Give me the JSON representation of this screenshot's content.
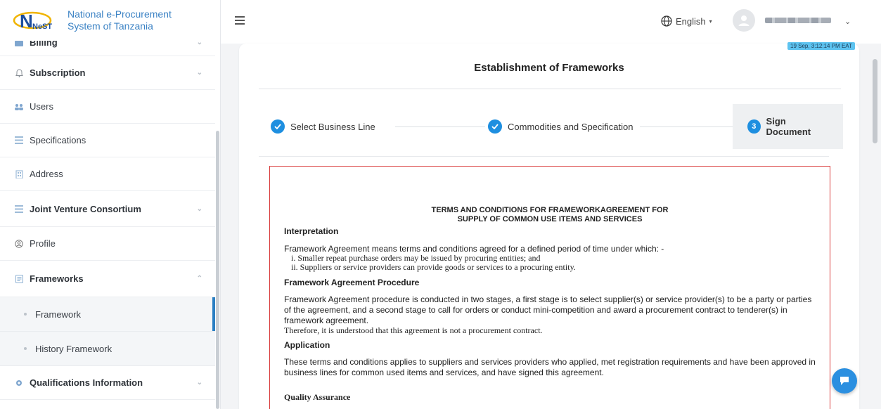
{
  "app": {
    "name_line1": "National e-Procurement",
    "name_line2": "System of Tanzania",
    "logo_text": "NeST",
    "brand_color": "#3b82c4"
  },
  "sidebar": {
    "items": [
      {
        "label": "Billing",
        "icon": "billing-icon",
        "bold": true,
        "has_chevron": true
      },
      {
        "label": "Subscription",
        "icon": "bell-icon",
        "bold": true,
        "has_chevron": true
      },
      {
        "label": "Users",
        "icon": "users-icon",
        "bold": false
      },
      {
        "label": "Specifications",
        "icon": "list-icon",
        "bold": false
      },
      {
        "label": "Address",
        "icon": "building-icon",
        "bold": false
      },
      {
        "label": "Joint Venture Consortium",
        "icon": "list-icon",
        "bold": true,
        "has_chevron": true
      },
      {
        "label": "Profile",
        "icon": "profile-icon",
        "bold": false
      },
      {
        "label": "Frameworks",
        "icon": "document-icon",
        "bold": true,
        "has_chevron": true,
        "expanded": true
      },
      {
        "label": "Qualifications Information",
        "icon": "gear-icon",
        "bold": true,
        "has_chevron": true
      }
    ],
    "subitems": [
      {
        "label": "Framework",
        "active": true
      },
      {
        "label": "History Framework",
        "active": false
      }
    ]
  },
  "topbar": {
    "language": "English",
    "clock": "19 Sep, 3:12:14 PM EAT"
  },
  "page": {
    "title": "Establishment of Frameworks",
    "steps": [
      {
        "label": "Select Business Line",
        "status": "done"
      },
      {
        "label": "Commodities and Specification",
        "status": "done"
      },
      {
        "number": "3",
        "label": "Sign Document",
        "status": "current"
      }
    ]
  },
  "document": {
    "heading_line1": "TERMS AND CONDITIONS FOR FRAMEWORKAGREEMENT FOR",
    "heading_line2": "SUPPLY OF COMMON USE ITEMS AND SERVICES",
    "interpretation_title": "Interpretation",
    "interpretation_text": "Framework Agreement means terms and conditions agreed for a defined period of time under which: -",
    "interpretation_item1": "i. Smaller repeat purchase orders may be issued by procuring entities; and",
    "interpretation_item2": "ii. Suppliers or service providers can provide goods or services to a procuring entity.",
    "procedure_title": "Framework Agreement Procedure",
    "procedure_text": "Framework Agreement procedure is conducted in two stages, a first stage is to select supplier(s) or service provider(s) to be a party or parties of the agreement, and a second stage to call for orders or conduct mini-competition and award a procurement contract to tenderer(s) in framework agreement.",
    "procedure_note": "Therefore, it is understood that this agreement is not a procurement contract.",
    "application_title": "Application",
    "application_text": "These terms and conditions applies to suppliers and services providers who applied, met registration requirements and have been approved in business lines for common used items and services, and have signed this agreement.",
    "quality_title": "Quality Assurance"
  },
  "colors": {
    "accent": "#1e8fe0",
    "doc_border": "#d93b3b",
    "active_bar": "#2b7fc3"
  }
}
